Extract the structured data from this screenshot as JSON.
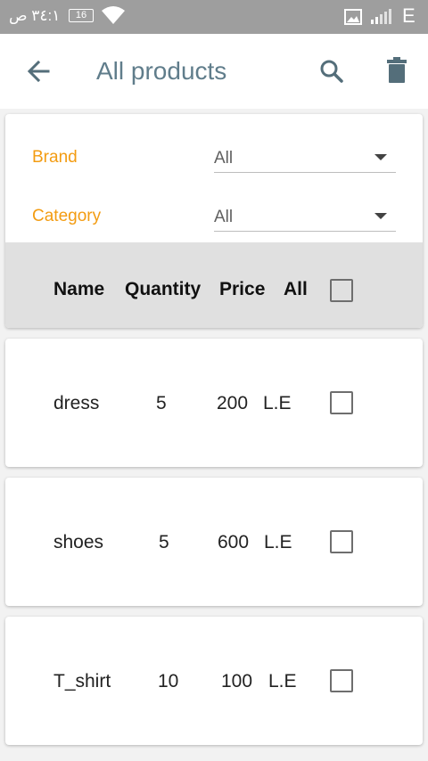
{
  "status_bar": {
    "time": "١:٤٣ ص",
    "battery": "16",
    "network": "E"
  },
  "app_bar": {
    "title": "All products",
    "back_icon": "arrow-back-icon",
    "search_icon": "search-icon",
    "delete_icon": "trash-icon"
  },
  "filters": {
    "brand_label": "Brand",
    "brand_value": "All",
    "category_label": "Category",
    "category_value": "All"
  },
  "table": {
    "headers": [
      "Name",
      "Quantity",
      "Price",
      "All"
    ],
    "select_all_checked": false
  },
  "products": [
    {
      "name": "dress",
      "quantity": "5",
      "price": "200",
      "currency": "L.E",
      "checked": false
    },
    {
      "name": "shoes",
      "quantity": "5",
      "price": "600",
      "currency": "L.E",
      "checked": false
    },
    {
      "name": "T_shirt",
      "quantity": "10",
      "price": "100",
      "currency": "L.E",
      "checked": false
    }
  ],
  "colors": {
    "accent_orange": "#f39c12",
    "title_slate": "#607d8b",
    "status_bar": "#9e9e9e",
    "header_gray": "#e0e0e0"
  }
}
